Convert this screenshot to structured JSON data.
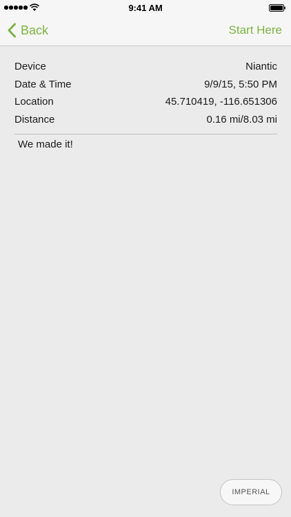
{
  "status_bar": {
    "time": "9:41 AM"
  },
  "nav": {
    "back_label": "Back",
    "right_label": "Start Here"
  },
  "details": {
    "rows": [
      {
        "label": "Device",
        "value": "Niantic"
      },
      {
        "label": "Date & Time",
        "value": "9/9/15, 5:50 PM"
      },
      {
        "label": "Location",
        "value": "45.710419, -116.651306"
      },
      {
        "label": "Distance",
        "value": "0.16 mi/8.03 mi"
      }
    ]
  },
  "note": "We made it!",
  "units_button": "IMPERIAL",
  "colors": {
    "accent": "#7cb342",
    "background": "#ebebeb",
    "bar": "#f6f6f6"
  },
  "icons": [
    "signal-dots-icon",
    "wifi-icon",
    "battery-icon",
    "chevron-left-icon"
  ]
}
